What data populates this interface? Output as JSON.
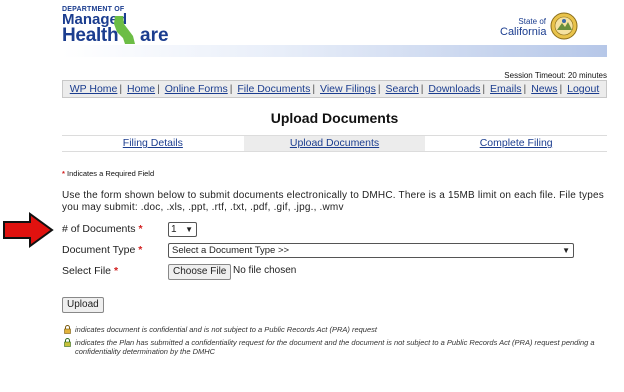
{
  "logo": {
    "dept": "DEPARTMENT OF",
    "managed": "Managed",
    "health": "Health",
    "care_rest": "are",
    "state_of": "State of",
    "california": "California"
  },
  "session": {
    "timeout": "Session Timeout: 20 minutes"
  },
  "nav": {
    "items": [
      "WP Home",
      "Home",
      "Online Forms",
      "File Documents",
      "View Filings",
      "Search",
      "Downloads",
      "Emails",
      "News",
      "Logout"
    ]
  },
  "page": {
    "title": "Upload Documents"
  },
  "tabs": [
    {
      "label": "Filing Details",
      "active": false
    },
    {
      "label": "Upload Documents",
      "active": true
    },
    {
      "label": "Complete Filing",
      "active": false
    }
  ],
  "required_note": "Indicates a Required Field",
  "description": "Use the form shown below to submit documents electronically to DMHC. There is a 15MB limit on each file. File types you may submit: .doc, .xls, .ppt, .rtf, .txt, .pdf, .gif, .jpg., .wmv",
  "form": {
    "num_docs_label": "# of Documents",
    "num_docs_value": "1",
    "doc_type_label": "Document Type",
    "doc_type_value": "Select a Document Type >>",
    "select_file_label": "Select File",
    "choose_file_button": "Choose File",
    "file_status": "No file chosen",
    "upload_button": "Upload",
    "required_star": "*"
  },
  "legend": {
    "confidential": "indicates document is confidential and is not subject to a Public Records Act (PRA) request",
    "pending": "indicates the Plan has submitted a confidentiality request for the document and the document is not subject to a Public Records Act (PRA) request pending a confidentiality determination by the DMHC"
  },
  "colors": {
    "brand_blue": "#1b3d8f",
    "logo_green": "#6cbd45",
    "arrow_red": "#e0120f",
    "required_red": "#d21f1f"
  },
  "icons": [
    "state-seal-icon",
    "arrow-right-icon",
    "lock-gold-icon",
    "lock-green-icon",
    "chevron-down-icon"
  ]
}
